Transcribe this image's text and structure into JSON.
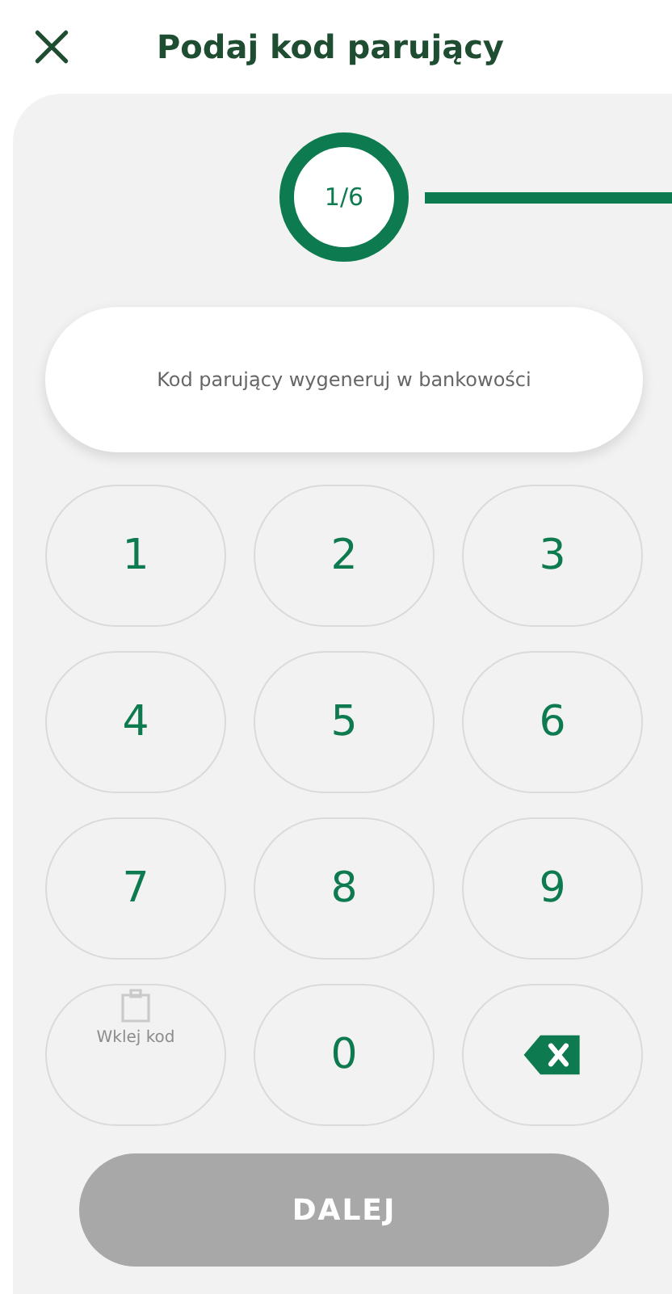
{
  "header": {
    "title": "Podaj kod parujący"
  },
  "stepper": {
    "step": "1/6"
  },
  "code_field": {
    "placeholder": "Kod parujący wygeneruj w bankowości"
  },
  "keypad": [
    {
      "kind": "digit",
      "label": "1"
    },
    {
      "kind": "digit",
      "label": "2"
    },
    {
      "kind": "digit",
      "label": "3"
    },
    {
      "kind": "digit",
      "label": "4"
    },
    {
      "kind": "digit",
      "label": "5"
    },
    {
      "kind": "digit",
      "label": "6"
    },
    {
      "kind": "digit",
      "label": "7"
    },
    {
      "kind": "digit",
      "label": "8"
    },
    {
      "kind": "digit",
      "label": "9"
    },
    {
      "kind": "paste",
      "label": "Wklej kod"
    },
    {
      "kind": "digit",
      "label": "0"
    },
    {
      "kind": "backspace"
    }
  ],
  "next_button": {
    "label": "DALEJ",
    "disabled": true
  }
}
